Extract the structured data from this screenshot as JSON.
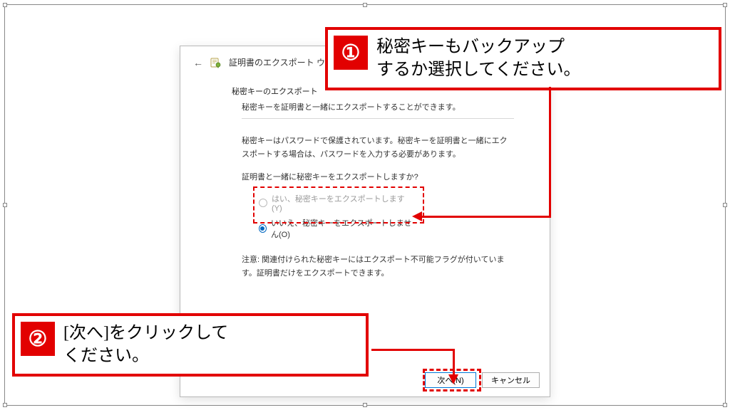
{
  "window": {
    "title": "証明書のエクスポート ウィザード"
  },
  "body": {
    "section_title": "秘密キーのエクスポート",
    "section_sub": "秘密キーを証明書と一緒にエクスポートすることができます。",
    "info": "秘密キーはパスワードで保護されています。秘密キーを証明書と一緒にエクスポートする場合は、パスワードを入力する必要があります。",
    "question": "証明書と一緒に秘密キーをエクスポートしますか?",
    "radio_yes": "はい、秘密キーをエクスポートします(Y)",
    "radio_no": "いいえ、秘密キーをエクスポートしません(O)",
    "note": "注意: 関連付けられた秘密キーにはエクスポート不可能フラグが付いています。証明書だけをエクスポートできます。"
  },
  "buttons": {
    "next": "次へ(N)",
    "cancel": "キャンセル"
  },
  "callouts": {
    "c1_num": "①",
    "c1_text": "秘密キーもバックアップ\nするか選択してください。",
    "c2_num": "②",
    "c2_text": "[次へ]をクリックして\nください。"
  }
}
